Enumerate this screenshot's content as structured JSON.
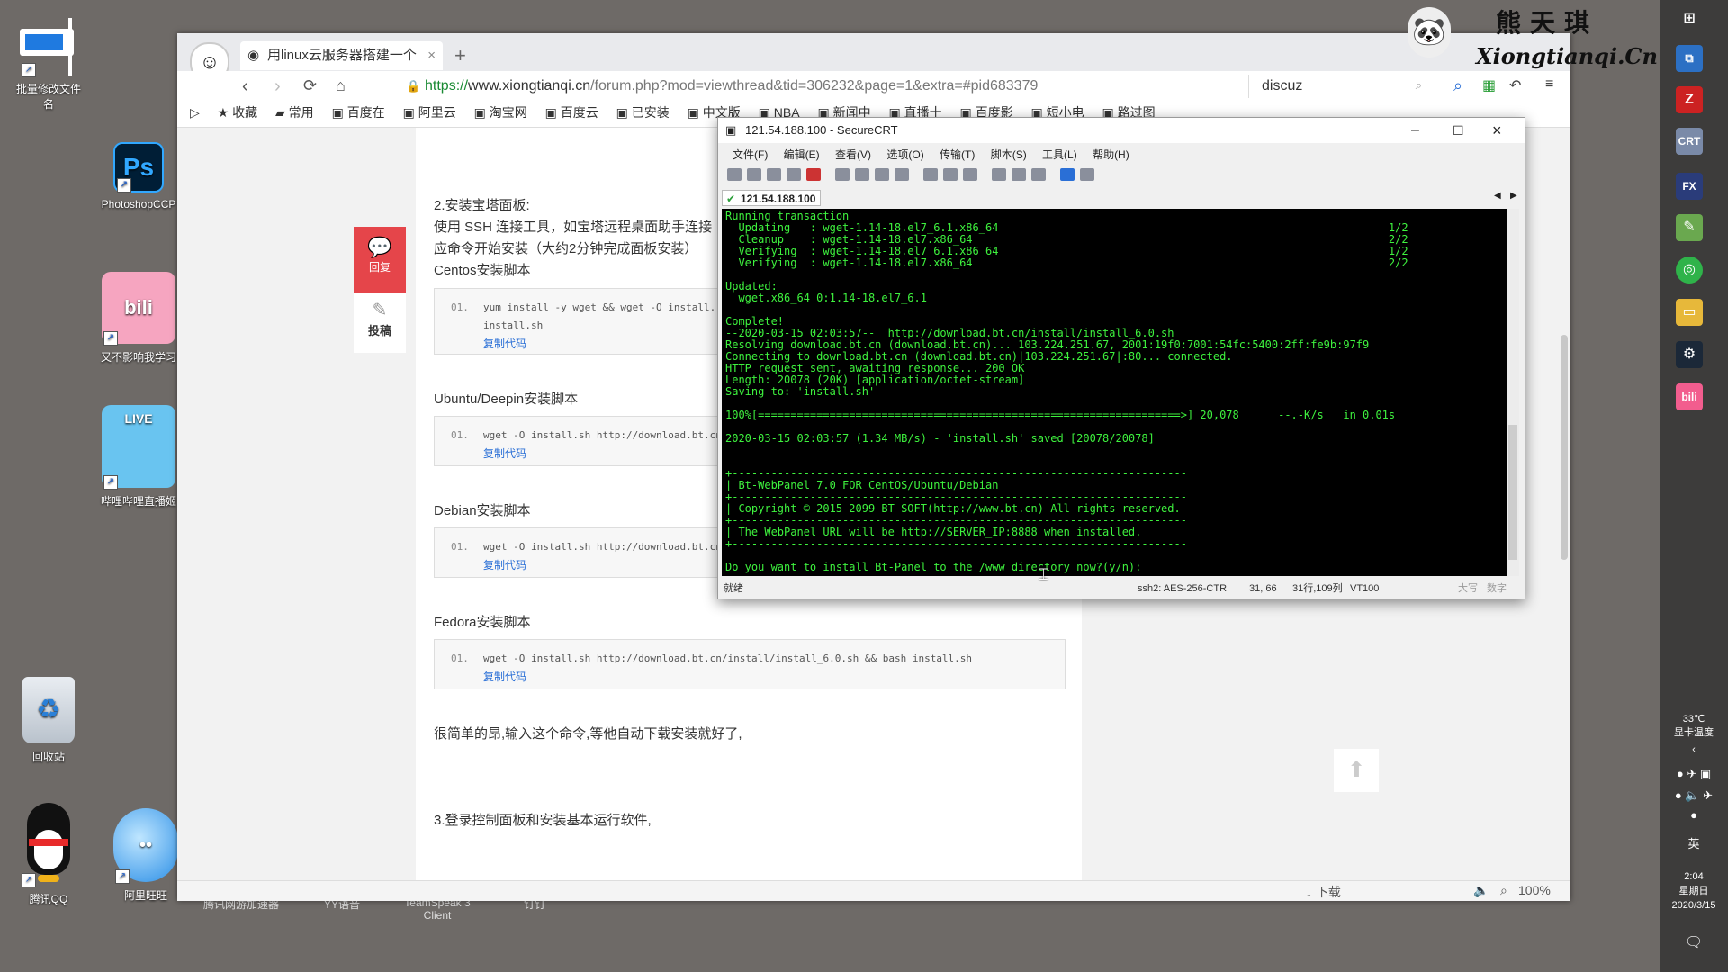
{
  "desktop": {
    "icons": [
      {
        "label": "批量修改文件名"
      },
      {
        "label": "PhotoshopCCP"
      },
      {
        "label": "又不影响我学习"
      },
      {
        "label": "哔哩哔哩直播姬"
      },
      {
        "label": "回收站"
      },
      {
        "label": "腾讯QQ"
      },
      {
        "label": "阿里旺旺"
      }
    ],
    "behind_labels": [
      "腾讯网游加速器",
      "YY语音",
      "TeamSpeak 3 Client",
      "钉钉"
    ]
  },
  "watermark": {
    "name": "熊天琪",
    "site": "Xiongtianqi.Cn"
  },
  "browser": {
    "tab_title": "用linux云服务器搭建一个",
    "url_scheme": "https://",
    "url_domain": "www.xiongtianqi.cn",
    "url_path": "/forum.php?mod=viewthread&tid=306232&page=1&extra=#pid683379",
    "search_value": "discuz",
    "bookmarks": [
      "收藏",
      "常用",
      "百度在",
      "阿里云",
      "淘宝网",
      "百度云",
      "已安装",
      "中文版",
      "NBA",
      "新闻中",
      "直播十",
      "百度影",
      "短小电",
      "路过图"
    ],
    "status": {
      "download": "下载",
      "zoom": "100%"
    }
  },
  "side_actions": {
    "reply": "回复",
    "post": "投稿"
  },
  "article": {
    "section2": "2.安装宝塔面板:",
    "section2_line1": "使用 SSH 连接工具，如宝塔远程桌面助手连接",
    "section2_line2": "应命令开始安装（大约2分钟完成面板安装）",
    "centos_label": "Centos安装脚本",
    "centos_code_line": "01.",
    "centos_code_a": "yum install -y wget && wget -O install.",
    "centos_code_b": "install.sh",
    "ubuntu_label": "Ubuntu/Deepin安装脚本",
    "ubuntu_code_line": "01.",
    "ubuntu_code": "wget -O install.sh http://download.bt.cn",
    "debian_label": "Debian安装脚本",
    "debian_code_line": "01.",
    "debian_code": "wget -O install.sh http://download.bt.cn",
    "fedora_label": "Fedora安装脚本",
    "fedora_code_line": "01.",
    "fedora_code": "wget -O install.sh http://download.bt.cn/install/install_6.0.sh && bash install.sh",
    "copy_label": "复制代码",
    "simple_text": "很简单的昂,输入这个命令,等他自动下载安装就好了,",
    "section3": "3.登录控制面板和安装基本运行软件,"
  },
  "securecrt": {
    "title": "121.54.188.100 - SecureCRT",
    "menu": [
      "文件(F)",
      "编辑(E)",
      "查看(V)",
      "选项(O)",
      "传输(T)",
      "脚本(S)",
      "工具(L)",
      "帮助(H)"
    ],
    "session_tab": "121.54.188.100",
    "terminal_lines": [
      "Running transaction",
      "  Updating   : wget-1.14-18.el7_6.1.x86_64                                                            1/2",
      "  Cleanup    : wget-1.14-18.el7.x86_64                                                                2/2",
      "  Verifying  : wget-1.14-18.el7_6.1.x86_64                                                            1/2",
      "  Verifying  : wget-1.14-18.el7.x86_64                                                                2/2",
      "",
      "Updated:",
      "  wget.x86_64 0:1.14-18.el7_6.1",
      "",
      "Complete!",
      "--2020-03-15 02:03:57--  http://download.bt.cn/install/install_6.0.sh",
      "Resolving download.bt.cn (download.bt.cn)... 103.224.251.67, 2001:19f0:7001:54fc:5400:2ff:fe9b:97f9",
      "Connecting to download.bt.cn (download.bt.cn)|103.224.251.67|:80... connected.",
      "HTTP request sent, awaiting response... 200 OK",
      "Length: 20078 (20K) [application/octet-stream]",
      "Saving to: 'install.sh'",
      "",
      "100%[=================================================================>] 20,078      --.-K/s   in 0.01s",
      "",
      "2020-03-15 02:03:57 (1.34 MB/s) - 'install.sh' saved [20078/20078]",
      "",
      "",
      "+----------------------------------------------------------------------",
      "| Bt-WebPanel 7.0 FOR CentOS/Ubuntu/Debian",
      "+----------------------------------------------------------------------",
      "| Copyright © 2015-2099 BT-SOFT(http://www.bt.cn) All rights reserved.",
      "+----------------------------------------------------------------------",
      "| The WebPanel URL will be http://SERVER_IP:8888 when installed.",
      "+----------------------------------------------------------------------",
      "",
      "Do you want to install Bt-Panel to the /www directory now?(y/n):"
    ],
    "status": {
      "ready": "就绪",
      "cipher": "ssh2: AES-256-CTR",
      "cursor": "31, 66",
      "size": "31行,109列",
      "term": "VT100",
      "caps": "大写",
      "num": "数字"
    }
  },
  "taskbar": {
    "temp": "33℃",
    "temp_label": "显卡温度",
    "ime": "英",
    "time": "2:04",
    "weekday": "星期日",
    "date": "2020/3/15"
  },
  "colors": {
    "terminal_fg": "#3ef23e",
    "terminal_bg": "#000000",
    "reply_red": "#e5454a",
    "link_blue": "#2a6fd6"
  }
}
